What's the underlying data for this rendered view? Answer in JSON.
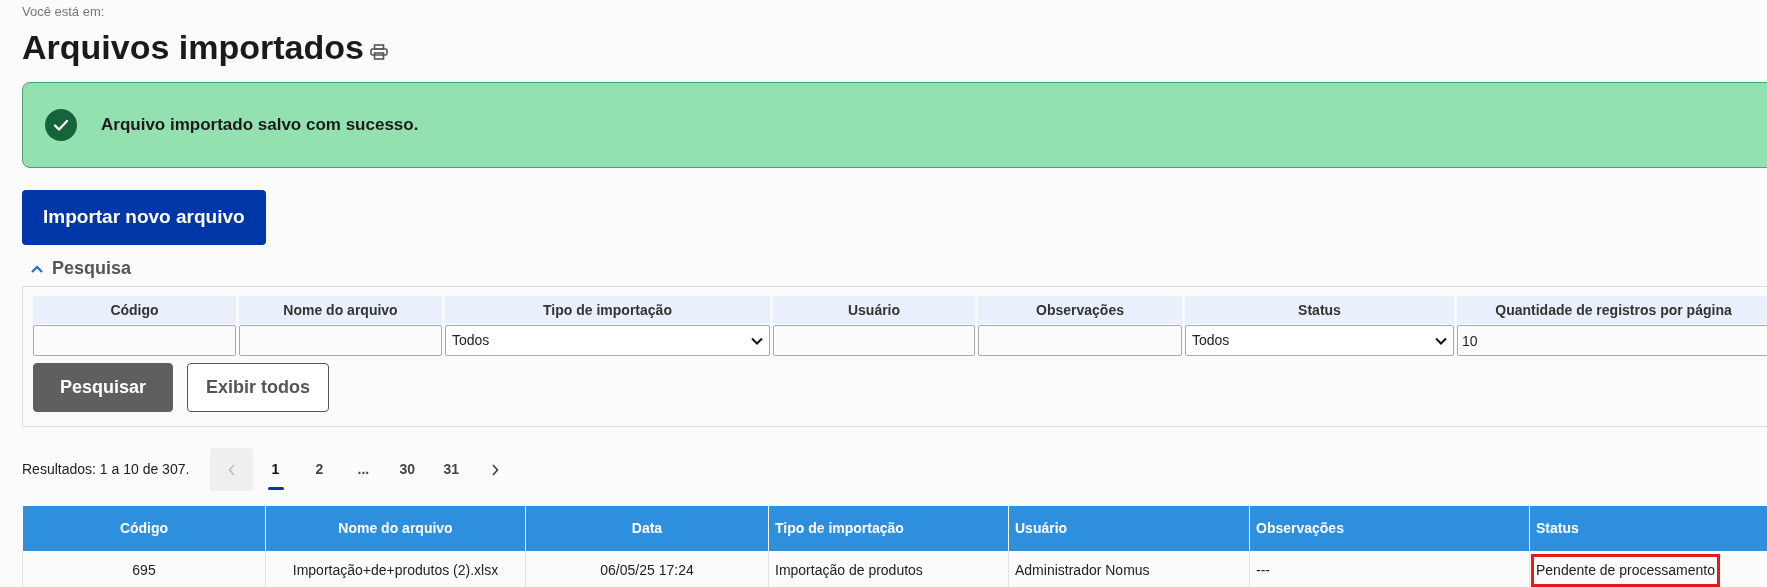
{
  "breadcrumb_label": "Você está em:",
  "title": "Arquivos importados",
  "alert": {
    "kind": "success",
    "message": "Arquivo importado salvo com sucesso."
  },
  "import_button": "Importar novo arquivo",
  "search": {
    "title": "Pesquisa",
    "expanded": true,
    "fields": [
      {
        "label": "Código",
        "kind": "text"
      },
      {
        "label": "Nome do arquivo",
        "kind": "text"
      },
      {
        "label": "Tipo de importação",
        "kind": "select",
        "value": "Todos"
      },
      {
        "label": "Usuário",
        "kind": "text"
      },
      {
        "label": "Observações",
        "kind": "text"
      },
      {
        "label": "Status",
        "kind": "select",
        "value": "Todos"
      },
      {
        "label": "Quantidade de registros por página",
        "kind": "text",
        "value": "10"
      }
    ],
    "buttons": [
      {
        "label": "Pesquisar",
        "kind": "primary"
      },
      {
        "label": "Exibir todos",
        "kind": "secondary"
      }
    ]
  },
  "results": {
    "summary": "Resultados: 1 a 10 de 307.",
    "pagination": {
      "prev_disabled": true,
      "pages": [
        {
          "label": "1",
          "selected": true
        },
        {
          "label": "2",
          "selected": false
        },
        {
          "label": "...",
          "selected": false
        },
        {
          "label": "30",
          "selected": false
        },
        {
          "label": "31",
          "selected": false
        }
      ]
    }
  },
  "table": {
    "columns": [
      "Código",
      "Nome do arquivo",
      "Data",
      "Tipo de importação",
      "Usuário",
      "Observações",
      "Status"
    ],
    "rows": [
      {
        "cells": [
          {
            "text": "695",
            "highlighted": false
          },
          {
            "text": "Importação+de+produtos (2).xlsx",
            "highlighted": false
          },
          {
            "text": "06/05/25 17:24",
            "highlighted": false
          },
          {
            "text": "Importação de produtos",
            "highlighted": false
          },
          {
            "text": "Administrador Nomus",
            "highlighted": false
          },
          {
            "text": "---",
            "highlighted": false
          },
          {
            "text": "Pendente de processamento",
            "highlighted": true
          }
        ]
      }
    ]
  }
}
